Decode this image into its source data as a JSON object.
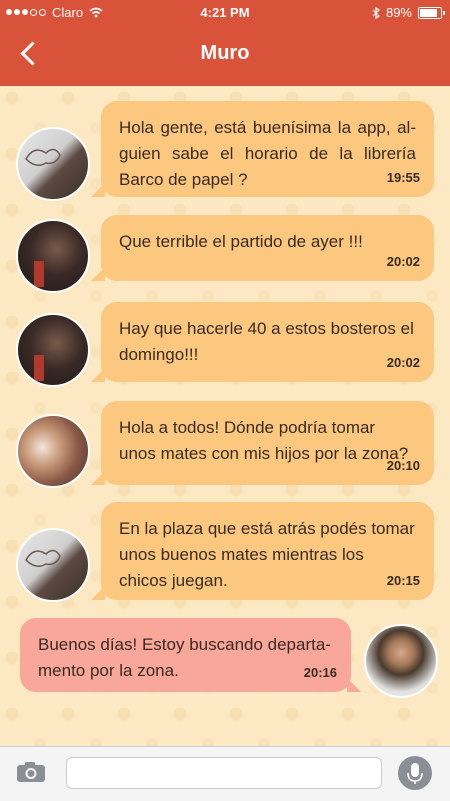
{
  "status_bar": {
    "carrier": "Claro",
    "time": "4:21 PM",
    "battery": "89%"
  },
  "header": {
    "title": "Muro"
  },
  "messages": [
    {
      "text": "Hola gente, está buenísima la app, al-guien sabe el horario de la librería Barco de papel ?",
      "time": "19:55"
    },
    {
      "text": "Que terrible el partido de ayer !!!",
      "time": "20:02"
    },
    {
      "text": "Hay que hacerle 40 a estos bosteros el domingo!!!",
      "time": "20:02"
    },
    {
      "text": "Hola a todos! Dónde podría tomar unos mates con mis hijos por la zona?",
      "time": "20:10"
    },
    {
      "text": "En la plaza que está atrás podés tomar unos buenos mates mientras los chicos juegan.",
      "time": "20:15"
    },
    {
      "text": "Buenos días! Estoy buscando departa-mento por la zona.",
      "time": "20:16"
    }
  ],
  "colors": {
    "header": "#d9523a",
    "bubble_incoming": "#fcc87f",
    "bubble_outgoing": "#f9a69b",
    "background": "#fce8c2"
  },
  "icons": {
    "back": "chevron-left-icon",
    "camera": "camera-icon",
    "mic": "microphone-icon"
  }
}
